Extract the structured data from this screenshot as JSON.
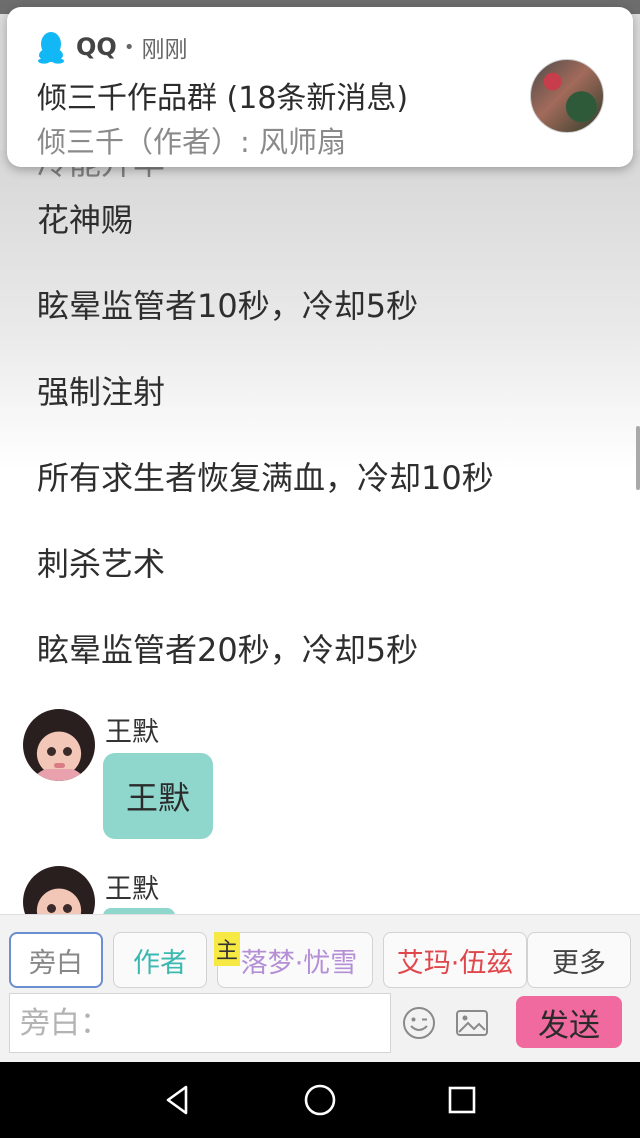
{
  "notification": {
    "app_name": "QQ",
    "separator": "•",
    "time": "刚刚",
    "title": "倾三千作品群 (18条新消息)",
    "body": "倾三千（作者）: 风师扇"
  },
  "story": {
    "peek_text": "冷能升华",
    "lines": [
      "花神赐",
      "眩晕监管者10秒，冷却5秒",
      "强制注射",
      "所有求生者恢复满血，冷却10秒",
      "刺杀艺术",
      "眩晕监管者20秒，冷却5秒"
    ]
  },
  "messages": [
    {
      "sender": "王默",
      "text": "王默"
    },
    {
      "sender": "王默",
      "text": ""
    }
  ],
  "composer": {
    "tabs": [
      {
        "label": "旁白",
        "color": "#888888"
      },
      {
        "label": "作者",
        "color": "#3bb8b0"
      },
      {
        "label": "落梦·忧雪",
        "color": "#b48fd6",
        "badge": "主"
      },
      {
        "label": "艾玛·伍兹",
        "color": "#e0474c"
      },
      {
        "label": "更多",
        "color": "#444444"
      }
    ],
    "input_placeholder": "旁白：",
    "send_label": "发送"
  },
  "colors": {
    "bubble": "#8fd7cc",
    "send_button": "#f06a9f",
    "badge": "#f6e943"
  }
}
